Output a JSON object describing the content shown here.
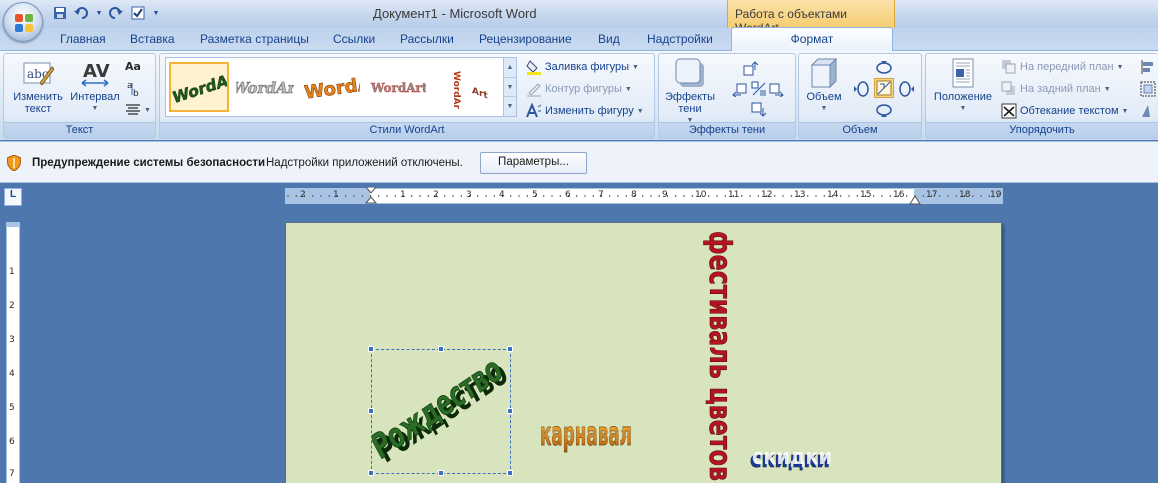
{
  "window": {
    "title": "Документ1 - Microsoft Word",
    "context_title": "Работа с объектами WordArt"
  },
  "tabs": [
    "Главная",
    "Вставка",
    "Разметка страницы",
    "Ссылки",
    "Рассылки",
    "Рецензирование",
    "Вид",
    "Надстройки"
  ],
  "active_tab": "Формат",
  "ribbon": {
    "text_group": {
      "label": "Текст",
      "edit_text": "Изменить текст",
      "edit_text_l1": "Изменить",
      "edit_text_l2": "текст",
      "spacing": "Интервал"
    },
    "styles_group": {
      "label": "Стили WordArt",
      "gallery_items": [
        "WordArt",
        "WordArt",
        "WordArt",
        "WordArt",
        "WordArt"
      ],
      "fill": "Заливка фигуры",
      "outline": "Контур фигуры",
      "change_shape": "Изменить фигуру"
    },
    "shadow_group": {
      "label": "Эффекты тени",
      "effects_l1": "Эффекты",
      "effects_l2": "тени"
    },
    "volume_group": {
      "label": "Объем",
      "volume": "Объем"
    },
    "arrange_group": {
      "label": "Упорядочить",
      "position": "Положение",
      "bring_front": "На передний план",
      "send_back": "На задний план",
      "wrap": "Обтекание текстом"
    }
  },
  "security_bar": {
    "title": "Предупреждение системы безопасности",
    "message": "Надстройки приложений отключены.",
    "button": "Параметры..."
  },
  "ruler": {
    "corner": "L",
    "h_labels": [
      "2",
      "1",
      "1",
      "2",
      "3",
      "4",
      "5",
      "6",
      "7",
      "8",
      "9",
      "10",
      "11",
      "12",
      "13",
      "14",
      "15",
      "16",
      "17",
      "18",
      "19"
    ],
    "v_labels": [
      "1",
      "1",
      "2",
      "3",
      "4",
      "5",
      "6",
      "7"
    ]
  },
  "document": {
    "wordart": {
      "rozhdestvo": "Рождество",
      "karnaval": "карнавал",
      "festival": "фестиваль цветов",
      "skidki": "скидки"
    }
  },
  "colors": {
    "page": "#d7e4bd",
    "rozhdestvo": "#1f5a1c",
    "karnaval": "#e58a1a",
    "festival": "#a3121d",
    "skidki": "#1a3d9a"
  }
}
